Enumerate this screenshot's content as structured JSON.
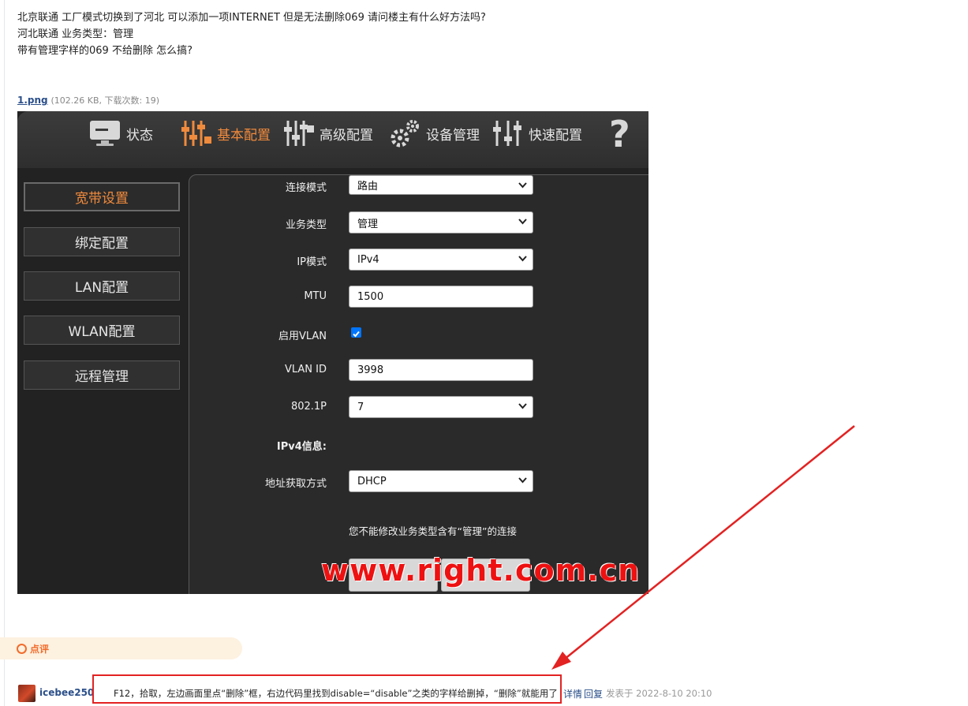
{
  "post": {
    "lines": [
      "北京联通 工厂模式切换到了河北 可以添加一项INTERNET 但是无法删除069 请问楼主有什么好方法吗?",
      "河北联通 业务类型：管理",
      "带有管理字样的069 不给删除 怎么搞?"
    ]
  },
  "attachment": {
    "name": "1.png",
    "meta": "(102.26 KB, 下载次数: 19)"
  },
  "router": {
    "nav": [
      "状态",
      "基本配置",
      "高级配置",
      "设备管理",
      "快速配置"
    ],
    "sidebar": [
      "宽带设置",
      "绑定配置",
      "LAN配置",
      "WLAN配置",
      "远程管理"
    ],
    "form": {
      "connection_mode_label": "连接模式",
      "connection_mode_value": "路由",
      "service_type_label": "业务类型",
      "service_type_value": "管理",
      "ip_mode_label": "IP模式",
      "ip_mode_value": "IPv4",
      "mtu_label": "MTU",
      "mtu_value": "1500",
      "vlan_enable_label": "启用VLAN",
      "vlan_enabled": true,
      "vlan_id_label": "VLAN ID",
      "vlan_id_value": "3998",
      "p8021_label": "802.1P",
      "p8021_value": "7",
      "ipv4_info_label": "IPv4信息:",
      "addr_mode_label": "地址获取方式",
      "addr_mode_value": "DHCP"
    },
    "note": "您不能修改业务类型含有“管理”的连接",
    "watermark": "www.right.com.cn"
  },
  "comments": {
    "tab_label": "点评"
  },
  "reply": {
    "username": "icebee250",
    "text": "F12，拾取，左边画面里点“删除”框，右边代码里找到disable=“disable”之类的字样给删掉，“删除”就能用了",
    "detail_link": "详情",
    "reply_link": "回复",
    "posted": "发表于 2022-8-10 20:10"
  },
  "colors": {
    "accent_orange": "#f08a3c",
    "annotation_red": "#e32222",
    "link_blue": "#2b4f8a"
  }
}
